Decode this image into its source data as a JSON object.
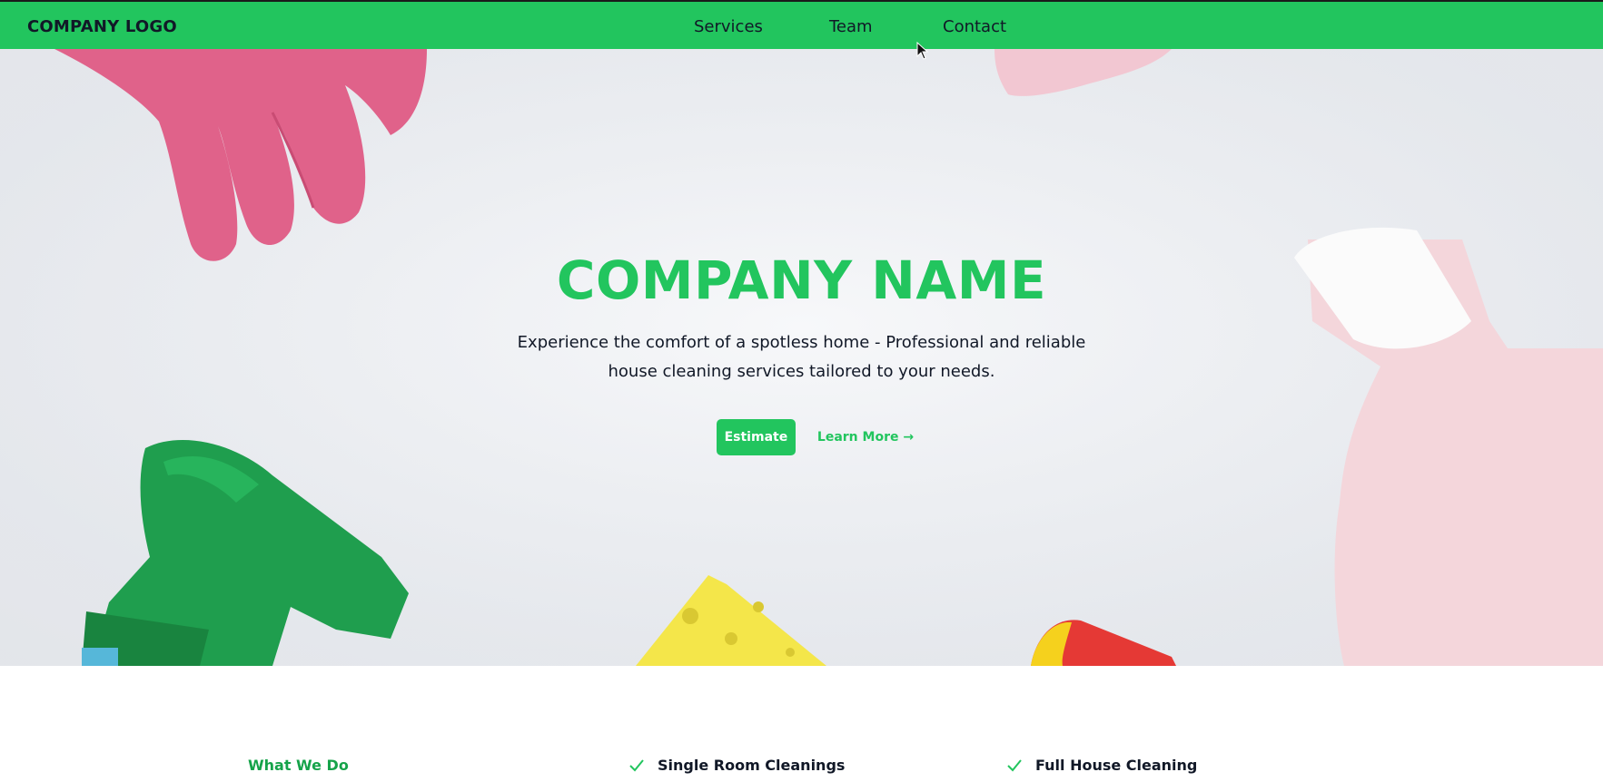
{
  "nav": {
    "logo": "COMPANY LOGO",
    "links": [
      "Services",
      "Team",
      "Contact"
    ]
  },
  "hero": {
    "title": "COMPANY NAME",
    "description": "Experience the comfort of a spotless home - Professional and reliable house cleaning services tailored to your needs.",
    "primary_button": "Estimate",
    "secondary_button": "Learn More →"
  },
  "services": {
    "heading": "What We Do",
    "items": [
      "Single Room Cleanings",
      "Full House Cleaning"
    ]
  },
  "colors": {
    "brand_green": "#22c55e",
    "dark_text": "#111827"
  },
  "icons": [
    "check-icon",
    "mouse-cursor-icon"
  ]
}
